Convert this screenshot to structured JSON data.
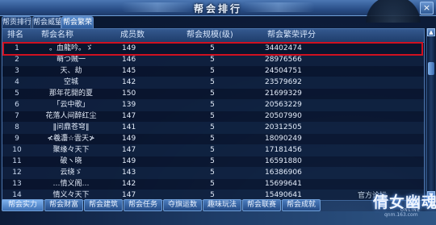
{
  "window": {
    "title": "帮会排行",
    "close_label": "×"
  },
  "tabs": [
    {
      "label": "帮贡排行",
      "active": false
    },
    {
      "label": "帮会威望",
      "active": false
    },
    {
      "label": "帮会繁荣",
      "active": true
    }
  ],
  "table": {
    "headers": {
      "rank": "排名",
      "name": "帮会名称",
      "members": "成员数",
      "scale": "帮会规模(级)",
      "score": "帮会繁荣评分"
    },
    "rows": [
      {
        "rank": "1",
        "name": "。血龍吟。ゞ",
        "members": "149",
        "scale": "5",
        "score": "34402474"
      },
      {
        "rank": "2",
        "name": "萌つ贼一",
        "members": "146",
        "scale": "5",
        "score": "28976566"
      },
      {
        "rank": "3",
        "name": "天、劫",
        "members": "145",
        "scale": "5",
        "score": "24504751"
      },
      {
        "rank": "4",
        "name": "空城",
        "members": "142",
        "scale": "5",
        "score": "23579692"
      },
      {
        "rank": "5",
        "name": "那年花開的夏",
        "members": "150",
        "scale": "5",
        "score": "21699329"
      },
      {
        "rank": "6",
        "name": "「云中歌」",
        "members": "139",
        "scale": "5",
        "score": "20563229"
      },
      {
        "rank": "7",
        "name": "花落人间醉红尘",
        "members": "147",
        "scale": "5",
        "score": "20507990"
      },
      {
        "rank": "8",
        "name": "‖问鼎苍穹‖",
        "members": "141",
        "scale": "5",
        "score": "20312505"
      },
      {
        "rank": "9",
        "name": "≮羲灋☆雲天≯",
        "members": "149",
        "scale": "5",
        "score": "18090249"
      },
      {
        "rank": "10",
        "name": "聚缘々天下",
        "members": "147",
        "scale": "5",
        "score": "17181456"
      },
      {
        "rank": "11",
        "name": "破ヽ晓",
        "members": "149",
        "scale": "5",
        "score": "16591880"
      },
      {
        "rank": "12",
        "name": "云绕ゞ",
        "members": "143",
        "scale": "5",
        "score": "16386906"
      },
      {
        "rank": "13",
        "name": "…情义阁…",
        "members": "142",
        "scale": "5",
        "score": "15699641"
      },
      {
        "rank": "14",
        "name": "情义々天下",
        "members": "147",
        "scale": "5",
        "score": "15490641"
      }
    ]
  },
  "scrollbar": {
    "up_icon": "▲",
    "down_icon": "▼"
  },
  "bottom_tabs": [
    {
      "label": "帮会实力",
      "active": true
    },
    {
      "label": "帮会财富",
      "active": false
    },
    {
      "label": "帮会建筑",
      "active": false
    },
    {
      "label": "帮会任务",
      "active": false
    },
    {
      "label": "夺旗运数",
      "active": false
    },
    {
      "label": "趣味玩法",
      "active": false
    },
    {
      "label": "帮会联赛",
      "active": false
    },
    {
      "label": "帮会成就",
      "active": false
    }
  ],
  "watermark": {
    "forum": "官方论坛",
    "logo": "倩女幽魂",
    "online": "ONLINE",
    "site": "qnm.163.com"
  },
  "colors": {
    "highlight": "#d01020",
    "title_bar": "#2a4f88"
  }
}
